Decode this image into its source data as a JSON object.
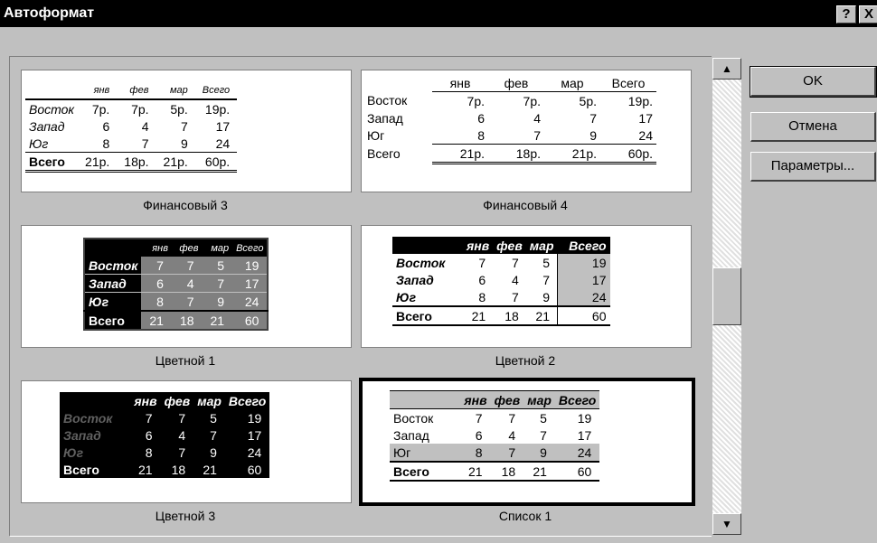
{
  "window": {
    "title": "Автоформат",
    "help_label": "?",
    "close_label": "X"
  },
  "buttons": {
    "ok": "OK",
    "cancel": "Отмена",
    "options": "Параметры..."
  },
  "scrollbar": {
    "up_arrow": "▲",
    "down_arrow": "▼"
  },
  "formats": [
    {
      "caption": "Финансовый 3",
      "header": [
        "",
        "янв",
        "фев",
        "мар",
        "Всего"
      ],
      "rows": [
        [
          "Восток",
          "7р.",
          "7р.",
          "5р.",
          "19р."
        ],
        [
          "Запад",
          "6",
          "4",
          "7",
          "17"
        ],
        [
          "Юг",
          "8",
          "7",
          "9",
          "24"
        ],
        [
          "Всего",
          "21р.",
          "18р.",
          "21р.",
          "60р."
        ]
      ]
    },
    {
      "caption": "Финансовый 4",
      "header": [
        "",
        "янв",
        "фев",
        "мар",
        "Всего"
      ],
      "rows": [
        [
          "Восток",
          "7р.",
          "7р.",
          "5р.",
          "19р."
        ],
        [
          "Запад",
          "6",
          "4",
          "7",
          "17"
        ],
        [
          "Юг",
          "8",
          "7",
          "9",
          "24"
        ],
        [
          "Всего",
          "21р.",
          "18р.",
          "21р.",
          "60р."
        ]
      ]
    },
    {
      "caption": "Цветной 1",
      "header": [
        "",
        "янв",
        "фев",
        "мар",
        "Всего"
      ],
      "rows": [
        [
          "Восток",
          "7",
          "7",
          "5",
          "19"
        ],
        [
          "Запад",
          "6",
          "4",
          "7",
          "17"
        ],
        [
          "Юг",
          "8",
          "7",
          "9",
          "24"
        ],
        [
          "Всего",
          "21",
          "18",
          "21",
          "60"
        ]
      ]
    },
    {
      "caption": "Цветной 2",
      "header": [
        "",
        "янв",
        "фев",
        "мар",
        "Всего"
      ],
      "rows": [
        [
          "Восток",
          "7",
          "7",
          "5",
          "19"
        ],
        [
          "Запад",
          "6",
          "4",
          "7",
          "17"
        ],
        [
          "Юг",
          "8",
          "7",
          "9",
          "24"
        ],
        [
          "Всего",
          "21",
          "18",
          "21",
          "60"
        ]
      ]
    },
    {
      "caption": "Цветной 3",
      "header": [
        "",
        "янв",
        "фев",
        "мар",
        "Всего"
      ],
      "rows": [
        [
          "Восток",
          "7",
          "7",
          "5",
          "19"
        ],
        [
          "Запад",
          "6",
          "4",
          "7",
          "17"
        ],
        [
          "Юг",
          "8",
          "7",
          "9",
          "24"
        ],
        [
          "Всего",
          "21",
          "18",
          "21",
          "60"
        ]
      ]
    },
    {
      "caption": "Список 1",
      "selected": true,
      "header": [
        "",
        "янв",
        "фев",
        "мар",
        "Всего"
      ],
      "rows": [
        [
          "Восток",
          "7",
          "7",
          "5",
          "19"
        ],
        [
          "Запад",
          "6",
          "4",
          "7",
          "17"
        ],
        [
          "Юг",
          "8",
          "7",
          "9",
          "24"
        ],
        [
          "Всего",
          "21",
          "18",
          "21",
          "60"
        ]
      ]
    }
  ]
}
